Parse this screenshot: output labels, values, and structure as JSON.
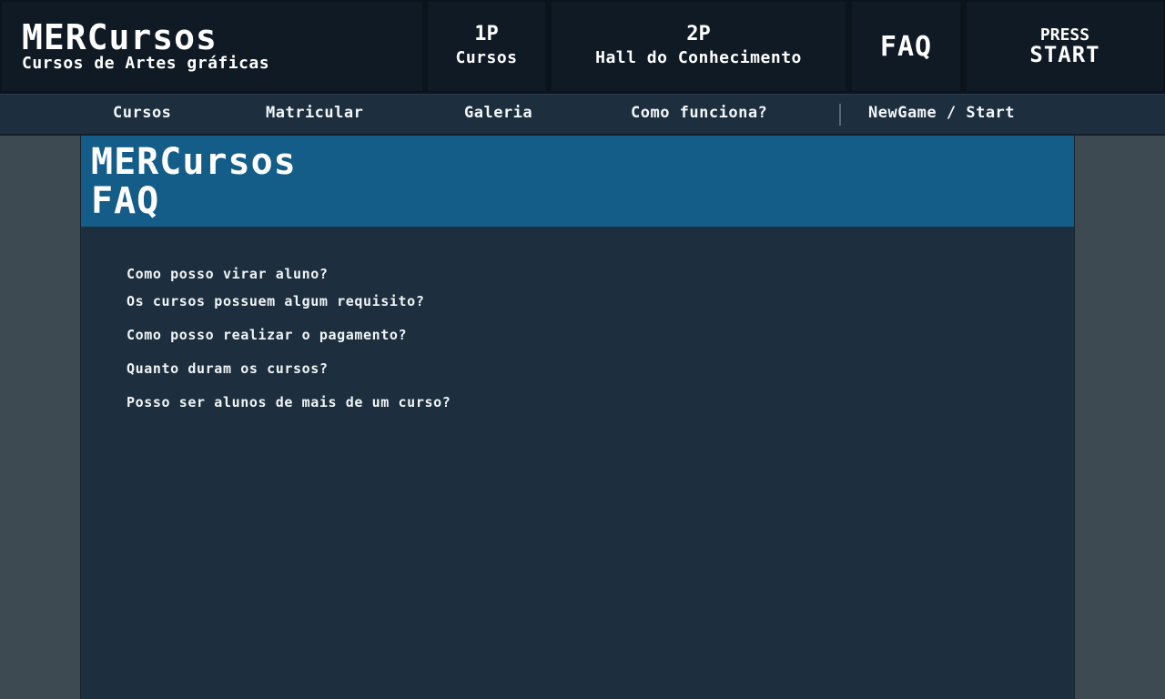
{
  "brand": {
    "title": "MERCursos",
    "subtitle": "Cursos de Artes gráficas"
  },
  "topnav": {
    "p1": {
      "num": "1P",
      "label": "Cursos"
    },
    "p2": {
      "num": "2P",
      "label": "Hall do Conhecimento"
    },
    "faq": {
      "label": "FAQ"
    },
    "start": {
      "press": "PRESS",
      "start": "START"
    }
  },
  "subnav": {
    "items": [
      "Cursos",
      "Matricular",
      "Galeria",
      "Como funciona?",
      "NewGame / Start"
    ]
  },
  "page": {
    "title_line1": "MERCursos",
    "title_line2": "FAQ"
  },
  "faq": {
    "questions": [
      "Como posso virar aluno?",
      "Os cursos possuem algum requisito?",
      "Como posso realizar o pagamento?",
      "Quanto duram os cursos?",
      "Posso ser alunos de mais de um curso?"
    ]
  },
  "colors": {
    "header_bg": "#101a24",
    "subnav_bg": "#1d2f3e",
    "panel_header_bg": "#135d88",
    "page_bg": "#3d4a52"
  }
}
